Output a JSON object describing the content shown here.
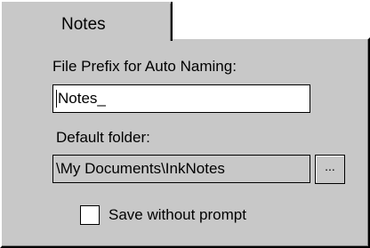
{
  "tab": {
    "label": "Notes"
  },
  "file_prefix": {
    "label": "File Prefix for Auto Naming:",
    "value": "Notes_"
  },
  "default_folder": {
    "label": "Default folder:",
    "value": "\\My Documents\\InkNotes",
    "browse_label": "..."
  },
  "save_without_prompt": {
    "label": "Save without prompt",
    "checked": false
  },
  "colors": {
    "panel_bg": "#c8c8c8",
    "input_bg": "#ffffff"
  }
}
